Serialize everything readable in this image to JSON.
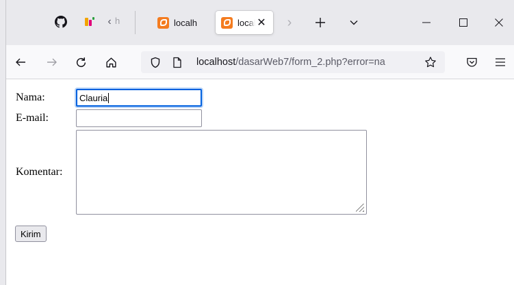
{
  "browser": {
    "tabs": [
      {
        "title": "localh",
        "active": false
      },
      {
        "title": "localhost",
        "active": true
      }
    ],
    "overflow_tab_fragment": "h",
    "url": {
      "host": "localhost",
      "path": "/dasarWeb7/form_2.php?error=na"
    },
    "icons": {
      "github": "github-icon",
      "pinned": "pinned-app-icon",
      "back": "back-arrow-icon",
      "forward": "forward-arrow-icon",
      "reload": "reload-icon",
      "home": "home-icon",
      "shield": "tracking-shield-icon",
      "page": "page-icon",
      "bookmark": "star-icon",
      "pocket": "pocket-icon",
      "menu": "hamburger-menu-icon"
    },
    "accent_color": "#0060df",
    "favicon_color": "#f47c20"
  },
  "form": {
    "name_label": "Nama:",
    "name_value": "Clauria",
    "email_label": "E-mail:",
    "email_value": "",
    "comment_label": "Komentar:",
    "comment_value": "",
    "submit_label": "Kirim"
  }
}
